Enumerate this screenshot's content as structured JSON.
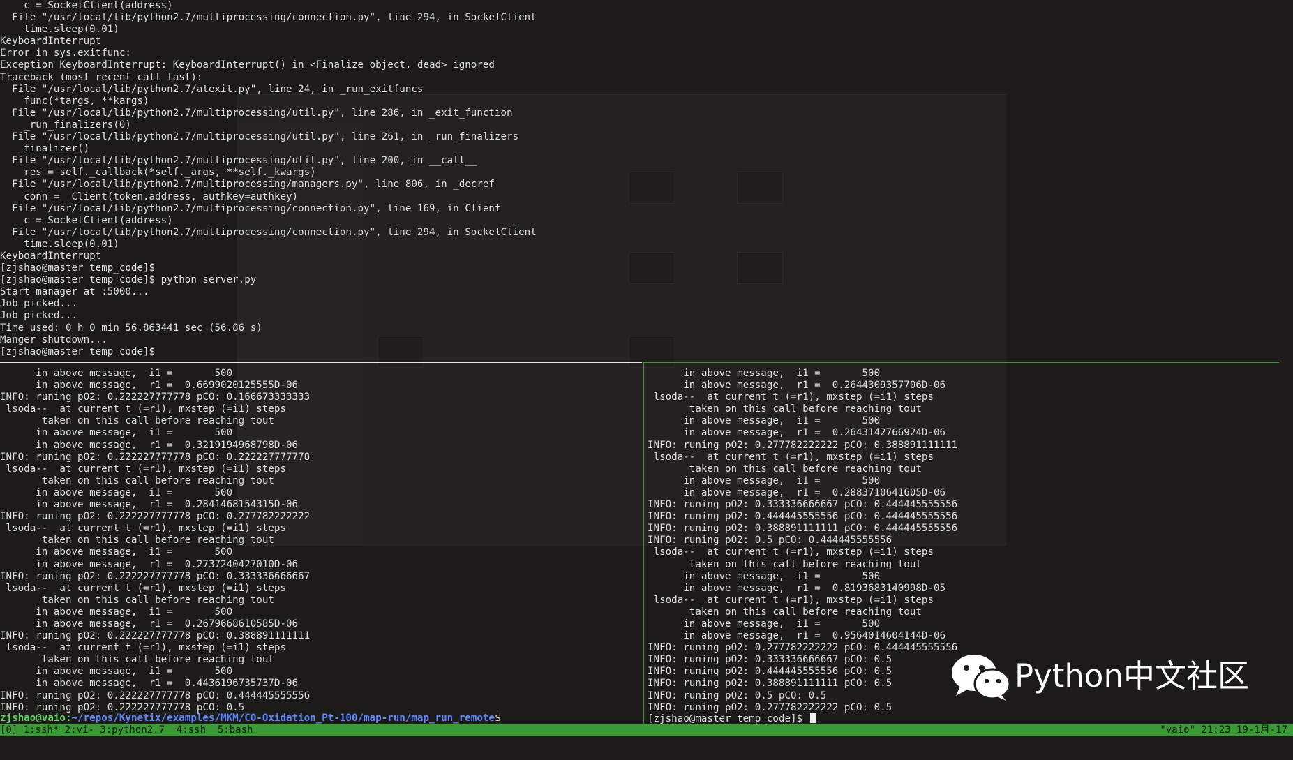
{
  "top_pane": {
    "lines": [
      "    c = SocketClient(address)",
      "  File \"/usr/local/lib/python2.7/multiprocessing/connection.py\", line 294, in SocketClient",
      "    time.sleep(0.01)",
      "KeyboardInterrupt",
      "Error in sys.exitfunc:",
      "Exception KeyboardInterrupt: KeyboardInterrupt() in <Finalize object, dead> ignored",
      "Traceback (most recent call last):",
      "  File \"/usr/local/lib/python2.7/atexit.py\", line 24, in _run_exitfuncs",
      "    func(*targs, **kargs)",
      "  File \"/usr/local/lib/python2.7/multiprocessing/util.py\", line 286, in _exit_function",
      "    _run_finalizers(0)",
      "  File \"/usr/local/lib/python2.7/multiprocessing/util.py\", line 261, in _run_finalizers",
      "    finalizer()",
      "  File \"/usr/local/lib/python2.7/multiprocessing/util.py\", line 200, in __call__",
      "    res = self._callback(*self._args, **self._kwargs)",
      "  File \"/usr/local/lib/python2.7/multiprocessing/managers.py\", line 806, in _decref",
      "    conn = _Client(token.address, authkey=authkey)",
      "  File \"/usr/local/lib/python2.7/multiprocessing/connection.py\", line 169, in Client",
      "    c = SocketClient(address)",
      "  File \"/usr/local/lib/python2.7/multiprocessing/connection.py\", line 294, in SocketClient",
      "    time.sleep(0.01)",
      "KeyboardInterrupt",
      "[zjshao@master temp_code]$",
      "[zjshao@master temp_code]$ python server.py",
      "Start manager at :5000...",
      "Job picked...",
      "Job picked...",
      "Time used: 0 h 0 min 56.863441 sec (56.86 s)",
      "Manger shutdown...",
      "[zjshao@master temp_code]$"
    ]
  },
  "bottom_left_pane": {
    "lines": [
      "      in above message,  i1 =       500",
      "      in above message,  r1 =  0.6699020125555D-06",
      "INFO: runing pO2: 0.222227777778 pCO: 0.166673333333",
      " lsoda--  at current t (=r1), mxstep (=i1) steps",
      "       taken on this call before reaching tout",
      "      in above message,  i1 =       500",
      "      in above message,  r1 =  0.3219194968798D-06",
      "INFO: runing pO2: 0.222227777778 pCO: 0.222227777778",
      " lsoda--  at current t (=r1), mxstep (=i1) steps",
      "       taken on this call before reaching tout",
      "      in above message,  i1 =       500",
      "      in above message,  r1 =  0.2841468154315D-06",
      "INFO: runing pO2: 0.222227777778 pCO: 0.277782222222",
      " lsoda--  at current t (=r1), mxstep (=i1) steps",
      "       taken on this call before reaching tout",
      "      in above message,  i1 =       500",
      "      in above message,  r1 =  0.2737240427010D-06",
      "INFO: runing pO2: 0.222227777778 pCO: 0.333336666667",
      " lsoda--  at current t (=r1), mxstep (=i1) steps",
      "       taken on this call before reaching tout",
      "      in above message,  i1 =       500",
      "      in above message,  r1 =  0.2679668610585D-06",
      "INFO: runing pO2: 0.222227777778 pCO: 0.388891111111",
      " lsoda--  at current t (=r1), mxstep (=i1) steps",
      "       taken on this call before reaching tout",
      "      in above message,  i1 =       500",
      "      in above message,  r1 =  0.4436196735737D-06",
      "INFO: runing pO2: 0.222227777778 pCO: 0.444445555556",
      "INFO: runing pO2: 0.222227777778 pCO: 0.5"
    ],
    "prompt_user": "zjshao@vaio:",
    "prompt_path": "~/repos/Kynetix/examples/MKM/CO-Oxidation_Pt-100/map-run/map_run_remote",
    "prompt_symbol": "$"
  },
  "bottom_right_pane": {
    "lines": [
      "      in above message,  i1 =       500",
      "      in above message,  r1 =  0.2644309357706D-06",
      " lsoda--  at current t (=r1), mxstep (=i1) steps",
      "       taken on this call before reaching tout",
      "      in above message,  i1 =       500",
      "      in above message,  r1 =  0.2643142766924D-06",
      "INFO: runing pO2: 0.277782222222 pCO: 0.388891111111",
      " lsoda--  at current t (=r1), mxstep (=i1) steps",
      "       taken on this call before reaching tout",
      "      in above message,  i1 =       500",
      "      in above message,  r1 =  0.2883710641605D-06",
      "INFO: runing pO2: 0.333336666667 pCO: 0.444445555556",
      "INFO: runing pO2: 0.444445555556 pCO: 0.444445555556",
      "INFO: runing pO2: 0.388891111111 pCO: 0.444445555556",
      "INFO: runing pO2: 0.5 pCO: 0.444445555556",
      " lsoda--  at current t (=r1), mxstep (=i1) steps",
      "       taken on this call before reaching tout",
      "      in above message,  i1 =       500",
      "      in above message,  r1 =  0.8193683140998D-05",
      " lsoda--  at current t (=r1), mxstep (=i1) steps",
      "       taken on this call before reaching tout",
      "      in above message,  i1 =       500",
      "      in above message,  r1 =  0.9564014604144D-06",
      "INFO: runing pO2: 0.277782222222 pCO: 0.444445555556",
      "INFO: runing pO2: 0.333336666667 pCO: 0.5",
      "INFO: runing pO2: 0.444445555556 pCO: 0.5",
      "INFO: runing pO2: 0.388891111111 pCO: 0.5",
      "INFO: runing pO2: 0.5 pCO: 0.5",
      "INFO: runing pO2: 0.277782222222 pCO: 0.5"
    ],
    "prompt": "[zjshao@master temp_code]$ "
  },
  "statusbar": {
    "windows": "[0] 1:ssh* 2:vi- 3:python2.7  4:ssh  5:bash",
    "right": "\"vaio\" 21:23 19-1月-17"
  },
  "watermark": {
    "text": "Python中文社区",
    "icon": "wechat-icon"
  },
  "colors": {
    "background": "#1c1b1a",
    "text": "#dedede",
    "status_bar": "#3a9a36",
    "pane_border_active": "#2ea12e",
    "prompt_user": "#5fd75f",
    "prompt_path": "#5f87ff"
  }
}
